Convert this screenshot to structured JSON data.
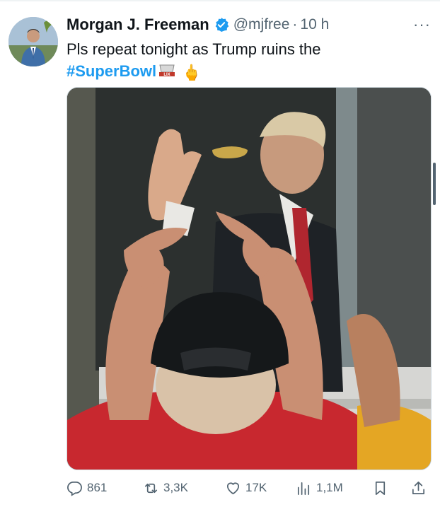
{
  "tweet": {
    "author_name": "Morgan J. Freeman",
    "handle": "@mjfree",
    "separator": "·",
    "time": "10 h",
    "more_label": "···",
    "text_line1": "Pls repeat tonight as Trump ruins the",
    "hashtag": "#SuperBowl",
    "bowl_emoji_text": "LIX",
    "emoji": "🖕"
  },
  "actions": {
    "replies": "861",
    "reposts": "3,3K",
    "likes": "17K",
    "views": "1,1M"
  },
  "colors": {
    "accent": "#1d9bf0",
    "muted": "#536471",
    "text": "#0f1419"
  }
}
